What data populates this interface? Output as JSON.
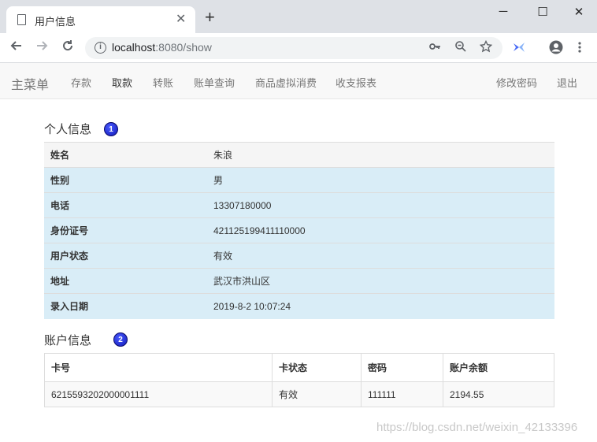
{
  "browser": {
    "tab_title": "用户信息",
    "tab_close": "✕",
    "new_tab": "+",
    "win_min": "─",
    "win_max": "☐",
    "win_close": "✕",
    "url_host": "localhost",
    "url_rest": ":8080/show",
    "icons": [
      "back-icon",
      "forward-icon",
      "reload-icon",
      "info-icon",
      "key-icon",
      "zoom-out-icon",
      "star-icon",
      "extension-icon",
      "account-icon",
      "menu-icon"
    ]
  },
  "nav": {
    "brand": "主菜单",
    "items": [
      "存款",
      "取款",
      "转账",
      "账单查询",
      "商品虚拟消费",
      "收支报表"
    ],
    "active": "取款",
    "right_items": [
      "修改密码",
      "退出"
    ]
  },
  "personal": {
    "title": "个人信息",
    "badge": "1",
    "rows": [
      {
        "label": "姓名",
        "value": "朱浪"
      },
      {
        "label": "性别",
        "value": "男"
      },
      {
        "label": "电话",
        "value": "13307180000"
      },
      {
        "label": "身份证号",
        "value": "421125199411110000"
      },
      {
        "label": "用户状态",
        "value": "有效"
      },
      {
        "label": "地址",
        "value": "武汉市洪山区"
      },
      {
        "label": "录入日期",
        "value": "2019-8-2 10:07:24"
      }
    ]
  },
  "account": {
    "title": "账户信息",
    "badge": "2",
    "headers": [
      "卡号",
      "卡状态",
      "密码",
      "账户余额"
    ],
    "rows": [
      [
        "6215593202000001111",
        "有效",
        "111111",
        "2194.55"
      ]
    ]
  },
  "watermark": "https://blog.csdn.net/weixin_42133396"
}
